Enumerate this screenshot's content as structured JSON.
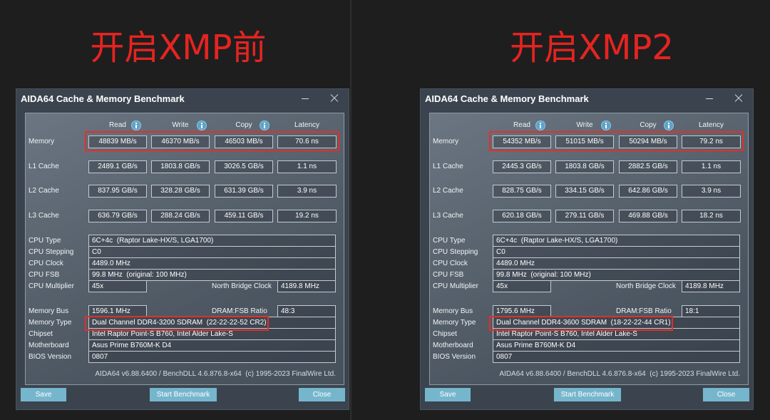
{
  "colors": {
    "page_background": "#1e1e1e",
    "heading_red": "#e52421",
    "highlight_red": "#e0302a",
    "window_background": "#3b444e",
    "button_blue": "#76b6cd",
    "info_icon_blue": "#5fa3c9"
  },
  "icons": {
    "minimize": "minimize-icon",
    "close": "close-icon",
    "info": "info-icon"
  },
  "panels": [
    {
      "heading": "开启XMP前",
      "window": {
        "title": "AIDA64 Cache & Memory Benchmark",
        "columns": [
          "Read",
          "Write",
          "Copy",
          "Latency"
        ],
        "cache_rows": [
          {
            "label": "Memory",
            "read": "48839 MB/s",
            "write": "46370 MB/s",
            "copy": "46503 MB/s",
            "latency": "70.6 ns"
          },
          {
            "label": "L1 Cache",
            "read": "2489.1 GB/s",
            "write": "1803.8 GB/s",
            "copy": "3026.5 GB/s",
            "latency": "1.1 ns"
          },
          {
            "label": "L2 Cache",
            "read": "837.95 GB/s",
            "write": "328.28 GB/s",
            "copy": "631.39 GB/s",
            "latency": "3.9 ns"
          },
          {
            "label": "L3 Cache",
            "read": "636.79 GB/s",
            "write": "288.24 GB/s",
            "copy": "459.11 GB/s",
            "latency": "19.2 ns"
          }
        ],
        "cpu_info": [
          {
            "label": "CPU Type",
            "value": "6C+4c  (Raptor Lake-HX/S, LGA1700)"
          },
          {
            "label": "CPU Stepping",
            "value": "C0"
          },
          {
            "label": "CPU Clock",
            "value": "4489.0 MHz"
          },
          {
            "label": "CPU FSB",
            "value": "99.8 MHz  (original: 100 MHz)"
          },
          {
            "label": "CPU Multiplier",
            "value": "45x"
          }
        ],
        "north_bridge_clock": {
          "label": "North Bridge Clock",
          "value": "4189.8 MHz"
        },
        "memory_info": [
          {
            "label": "Memory Bus",
            "value": "1596.1 MHz"
          },
          {
            "label": "Memory Type",
            "value": "Dual Channel DDR4-3200 SDRAM  (22-22-22-52 CR2)"
          },
          {
            "label": "Chipset",
            "value": "Intel Raptor Point-S B760, Intel Alder Lake-S"
          },
          {
            "label": "Motherboard",
            "value": "Asus Prime B760M-K D4"
          },
          {
            "label": "BIOS Version",
            "value": "0807"
          }
        ],
        "dram_fsb_ratio": {
          "label": "DRAM:FSB Ratio",
          "value": "48:3"
        },
        "footer": "AIDA64 v6.88.6400 / BenchDLL 4.6.876.8-x64  (c) 1995-2023 FinalWire Ltd.",
        "buttons": {
          "save": "Save",
          "start_benchmark": "Start Benchmark",
          "close": "Close"
        }
      }
    },
    {
      "heading": "开启XMP2",
      "window": {
        "title": "AIDA64 Cache & Memory Benchmark",
        "columns": [
          "Read",
          "Write",
          "Copy",
          "Latency"
        ],
        "cache_rows": [
          {
            "label": "Memory",
            "read": "54352 MB/s",
            "write": "51015 MB/s",
            "copy": "50294 MB/s",
            "latency": "79.2 ns"
          },
          {
            "label": "L1 Cache",
            "read": "2445.3 GB/s",
            "write": "1803.8 GB/s",
            "copy": "2882.5 GB/s",
            "latency": "1.1 ns"
          },
          {
            "label": "L2 Cache",
            "read": "828.75 GB/s",
            "write": "334.15 GB/s",
            "copy": "642.86 GB/s",
            "latency": "3.9 ns"
          },
          {
            "label": "L3 Cache",
            "read": "620.18 GB/s",
            "write": "279.11 GB/s",
            "copy": "469.88 GB/s",
            "latency": "18.2 ns"
          }
        ],
        "cpu_info": [
          {
            "label": "CPU Type",
            "value": "6C+4c  (Raptor Lake-HX/S, LGA1700)"
          },
          {
            "label": "CPU Stepping",
            "value": "C0"
          },
          {
            "label": "CPU Clock",
            "value": "4489.0 MHz"
          },
          {
            "label": "CPU FSB",
            "value": "99.8 MHz  (original: 100 MHz)"
          },
          {
            "label": "CPU Multiplier",
            "value": "45x"
          }
        ],
        "north_bridge_clock": {
          "label": "North Bridge Clock",
          "value": "4189.8 MHz"
        },
        "memory_info": [
          {
            "label": "Memory Bus",
            "value": "1795.6 MHz"
          },
          {
            "label": "Memory Type",
            "value": "Dual Channel DDR4-3600 SDRAM  (18-22-22-44 CR1)"
          },
          {
            "label": "Chipset",
            "value": "Intel Raptor Point-S B760, Intel Alder Lake-S"
          },
          {
            "label": "Motherboard",
            "value": "Asus Prime B760M-K D4"
          },
          {
            "label": "BIOS Version",
            "value": "0807"
          }
        ],
        "dram_fsb_ratio": {
          "label": "DRAM:FSB Ratio",
          "value": "18:1"
        },
        "footer": "AIDA64 v6.88.6400 / BenchDLL 4.6.876.8-x64  (c) 1995-2023 FinalWire Ltd.",
        "buttons": {
          "save": "Save",
          "start_benchmark": "Start Benchmark",
          "close": "Close"
        }
      }
    }
  ]
}
